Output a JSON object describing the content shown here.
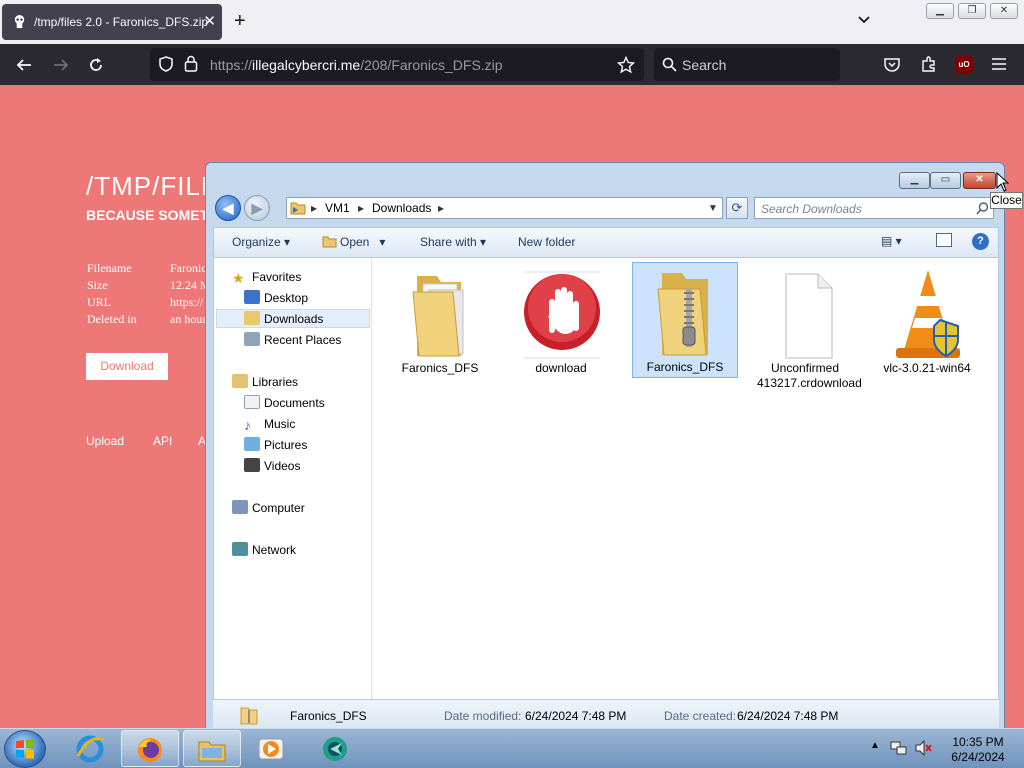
{
  "browser": {
    "tab_title": "/tmp/files 2.0 - Faronics_DFS.zip",
    "tab_close": "✕",
    "new_tab": "+",
    "url_scheme": "https://",
    "url_host": "illegalcybercri.me",
    "url_path": "/208/Faronics_DFS.zip",
    "search_placeholder": "Search",
    "extension_badge": "uO"
  },
  "webpage": {
    "site_title": "/TMP/FILE",
    "site_subtitle": "BECAUSE SOMET",
    "info": [
      {
        "label": "Filename",
        "value": "Faronic"
      },
      {
        "label": "Size",
        "value": "12.24 M"
      },
      {
        "label": "URL",
        "value": "https://"
      },
      {
        "label": "Deleted in",
        "value": "an hour"
      }
    ],
    "download_button": "Download",
    "footer_links": [
      "Upload",
      "API",
      "A"
    ],
    "background_color": "#ed7877"
  },
  "explorer": {
    "breadcrumb": [
      "VM1",
      "Downloads"
    ],
    "search_placeholder": "Search Downloads",
    "toolbar": {
      "organize": "Organize",
      "open": "Open",
      "share_with": "Share with",
      "new_folder": "New folder"
    },
    "nav": {
      "favorites": "Favorites",
      "desktop": "Desktop",
      "downloads": "Downloads",
      "recent_places": "Recent Places",
      "libraries": "Libraries",
      "documents": "Documents",
      "music": "Music",
      "pictures": "Pictures",
      "videos": "Videos",
      "computer": "Computer",
      "network": "Network"
    },
    "files": [
      {
        "name": "Faronics_DFS",
        "icon": "folder-icon"
      },
      {
        "name": "download",
        "icon": "stop-hand-icon"
      },
      {
        "name": "Faronics_DFS",
        "icon": "zip-folder-icon"
      },
      {
        "name": "Unconfirmed 413217.crdownload",
        "icon": "blank-file-icon"
      },
      {
        "name": "vlc-3.0.21-win64",
        "icon": "vlc-installer-icon"
      }
    ],
    "details": {
      "name": "Faronics_DFS",
      "date_modified_label": "Date modified:",
      "date_modified": "6/24/2024 7:48 PM",
      "date_created_label": "Date created:",
      "date_created": "6/24/2024 7:48 PM"
    },
    "close_tooltip": "Close"
  },
  "taskbar": {
    "time": "10:35 PM",
    "date": "6/24/2024",
    "apps": [
      "internet-explorer",
      "firefox",
      "file-explorer",
      "media-player",
      "network-app"
    ]
  }
}
